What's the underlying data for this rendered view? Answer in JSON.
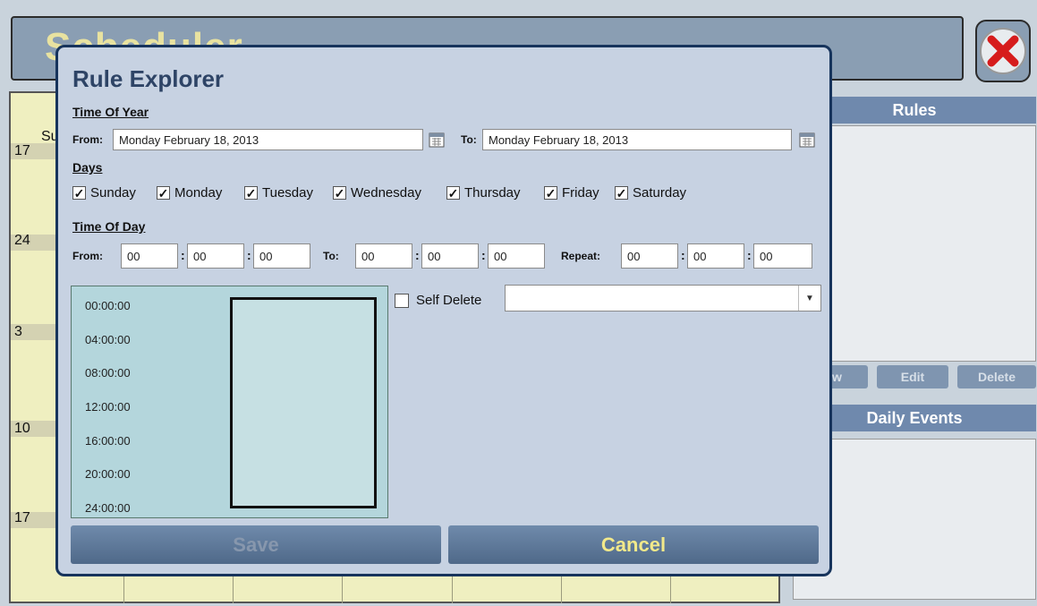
{
  "background": {
    "title": "Scheduler",
    "calendar": {
      "day_partial": "Su",
      "week_numbers": [
        "17",
        "24",
        "3",
        "10",
        "17"
      ]
    },
    "rules_panel": {
      "header": "Rules",
      "buttons": [
        "w",
        "Edit",
        "Delete"
      ]
    },
    "events_panel": {
      "header": "Daily Events"
    }
  },
  "modal": {
    "title": "Rule Explorer",
    "time_of_year": {
      "section_label": "Time Of Year",
      "from_label": "From:",
      "from_value": "Monday February 18, 2013",
      "to_label": "To:",
      "to_value": "Monday February 18, 2013"
    },
    "days": {
      "section_label": "Days",
      "items": [
        {
          "label": "Sunday",
          "checked": true
        },
        {
          "label": "Monday",
          "checked": true
        },
        {
          "label": "Tuesday",
          "checked": true
        },
        {
          "label": "Wednesday",
          "checked": true
        },
        {
          "label": "Thursday",
          "checked": true
        },
        {
          "label": "Friday",
          "checked": true
        },
        {
          "label": "Saturday",
          "checked": true
        }
      ]
    },
    "time_of_day": {
      "section_label": "Time Of Day",
      "from_label": "From:",
      "to_label": "To:",
      "repeat_label": "Repeat:",
      "separator": ":",
      "from": {
        "h": "00",
        "m": "00",
        "s": "00"
      },
      "to": {
        "h": "00",
        "m": "00",
        "s": "00"
      },
      "repeat": {
        "h": "00",
        "m": "00",
        "s": "00"
      }
    },
    "timeline_labels": [
      "00:00:00",
      "04:00:00",
      "08:00:00",
      "12:00:00",
      "16:00:00",
      "20:00:00",
      "24:00:00"
    ],
    "self_delete": {
      "label": "Self Delete",
      "checked": false,
      "selected": ""
    },
    "save_label": "Save",
    "cancel_label": "Cancel"
  },
  "colors": {
    "modal_bg": "#c7d2e2",
    "modal_border": "#17345c",
    "cancel_text": "#f2e98a",
    "save_text_disabled": "#8797ad",
    "timeline_bg": "#b4d6dc"
  }
}
